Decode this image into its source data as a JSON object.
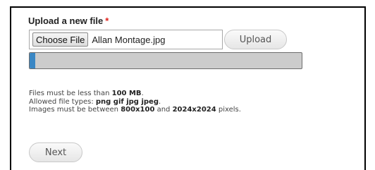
{
  "form": {
    "upload_label": "Upload a new file",
    "required_marker": "*",
    "choose_file_label": "Choose File",
    "selected_file_name": "Allan Montage.jpg",
    "upload_button_label": "Upload",
    "progress_percent": 2,
    "next_button_label": "Next"
  },
  "help": {
    "size_prefix": "Files must be less than ",
    "size_limit": "100 MB",
    "size_suffix": ".",
    "types_prefix": "Allowed file types: ",
    "types": "png gif jpg jpeg",
    "types_suffix": ".",
    "dims_prefix": "Images must be between ",
    "dims_min": "800x100",
    "dims_and": " and ",
    "dims_max": "2024x2024",
    "dims_suffix": " pixels."
  },
  "colors": {
    "required": "#e0221b",
    "progress_fill": "#3a87c4",
    "progress_track": "#cccccc"
  }
}
